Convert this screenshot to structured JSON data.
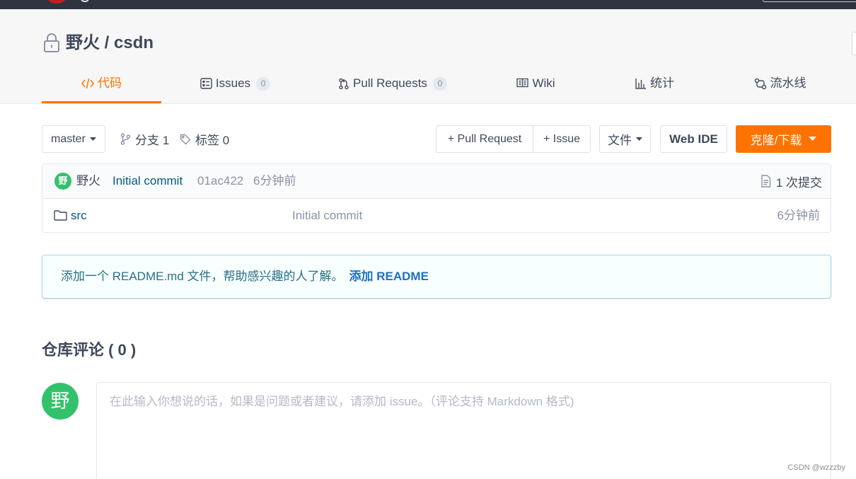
{
  "colors": {
    "nav_bg": "#2d3440",
    "brand_red": "#c71d23",
    "accent": "#fe7300",
    "text": "#40485b",
    "muted": "#8c92a4",
    "link": "#005980",
    "avatar_green": "#33c26b",
    "info_bg": "#f8ffff",
    "info_border": "#a9d5de",
    "info_text": "#276f86",
    "info_link": "#1e70bf"
  },
  "repo": {
    "title": "野火 / csdn",
    "visibility_icon": "lock-icon"
  },
  "tabs": [
    {
      "icon": "code-icon",
      "label": "代码",
      "active": true
    },
    {
      "icon": "issues-icon",
      "label": "Issues",
      "count": "0"
    },
    {
      "icon": "pull-request-icon",
      "label": "Pull Requests",
      "count": "0"
    },
    {
      "icon": "book-icon",
      "label": "Wiki"
    },
    {
      "icon": "bar-chart-icon",
      "label": "统计"
    },
    {
      "icon": "pipeline-icon",
      "label": "流水线"
    }
  ],
  "toolbar": {
    "branch_select": "master",
    "branches": "分支 1",
    "tags": "标签 0",
    "new_pull_request": "+ Pull Request",
    "new_issue": "+ Issue",
    "file_menu": "文件",
    "web_ide": "Web IDE",
    "clone_download": "克隆/下载"
  },
  "latest_commit": {
    "avatar": "野",
    "author": "野火",
    "message": "Initial commit",
    "hash": "01ac422",
    "time": "6分钟前",
    "commit_count": "1 次提交"
  },
  "files": [
    {
      "icon": "folder-icon",
      "name": "src",
      "commit_message": "Initial commit",
      "time": "6分钟前"
    }
  ],
  "readme_notice": {
    "text": "添加一个 README.md 文件，帮助感兴趣的人了解。",
    "link": "添加 README"
  },
  "comments": {
    "heading": "仓库评论 ( 0 )",
    "avatar": "野",
    "placeholder": "在此输入你想说的话，如果是问题或者建议，请添加 issue。（评论支持 Markdown 格式)"
  },
  "watermark": "CSDN @wzzzby"
}
